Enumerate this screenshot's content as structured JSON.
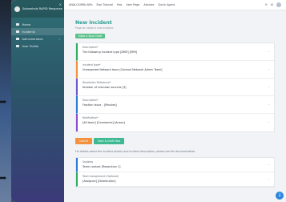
{
  "sidebar": {
    "title": "Solarwinds RAPID Response",
    "close_glyph": "×",
    "items": [
      {
        "label": "Home",
        "icon": "home-icon",
        "chevron": ""
      },
      {
        "label": "Incidents",
        "icon": "incident-icon",
        "chevron": ""
      },
      {
        "label": "Administration",
        "icon": "admin-icon",
        "chevron": "›"
      },
      {
        "label": "User Profile",
        "icon": "user-icon",
        "chevron": ""
      }
    ]
  },
  "topbar": {
    "links": [
      "ANALCAIIMA AIPo",
      "Star Tutorial",
      "Has",
      "User Page",
      "Advices",
      "Quick Agent"
    ],
    "right_glyphs": [
      "⟳",
      "⚙"
    ],
    "user": "—"
  },
  "page": {
    "title": "New Incident",
    "subtitle": "Page to create a new incident",
    "save_tag": "Make a Save Draft"
  },
  "fields": [
    {
      "label": "Description*",
      "value": "The following incident type [DRM] [ERR]",
      "color": "#2fae5f"
    },
    {
      "label": "Incident type*",
      "value": "Unexpected Network Issue [Contact Network Admin Team]",
      "color": "#f2913e"
    },
    {
      "label": "Resolution Reference*",
      "value": "Number of unknown sources [3]",
      "color": "#6a5acd"
    },
    {
      "label": "Description*",
      "value": "Fraction issue - [Minutes]",
      "color": "#2b7bd6"
    },
    {
      "label": "Notification*",
      "value": "[All team] [Comments] [Anson]",
      "color": "#8a4fd0"
    }
  ],
  "buttons": {
    "cancel": "Cancel",
    "save": "Save & Draft New"
  },
  "note": "For details about the incident priority and incident description, please see the documentation.",
  "lower_fields": [
    {
      "label": "Updates",
      "value": "Team contact [Resolution 1]",
      "color": "#2b7bd6"
    },
    {
      "label": "Team Assignment (Optional)",
      "value": "[Assignee] [Distribution]",
      "color": "#2fae5f"
    }
  ],
  "fab_glyph": "↓"
}
